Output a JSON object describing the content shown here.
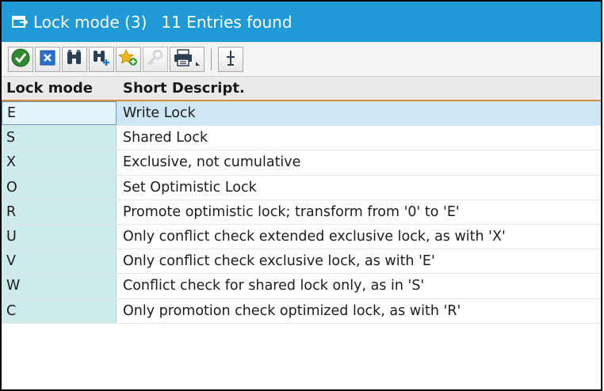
{
  "window": {
    "title_prefix": "Lock mode (3)",
    "title_suffix": "11 Entries found"
  },
  "toolbar": {
    "buttons": [
      {
        "icon": "check-icon"
      },
      {
        "icon": "cancel-x-icon"
      },
      {
        "icon": "binoculars-icon"
      },
      {
        "icon": "binoculars-plus-icon"
      },
      {
        "icon": "star-add-icon"
      },
      {
        "icon": "key-icon",
        "disabled": true
      },
      {
        "icon": "printer-icon"
      },
      {
        "icon": "column-marker-icon"
      }
    ]
  },
  "table": {
    "headers": [
      "Lock mode",
      "Short Descript."
    ],
    "rows": [
      {
        "mode": "E",
        "description": "Write Lock"
      },
      {
        "mode": "S",
        "description": "Shared Lock"
      },
      {
        "mode": "X",
        "description": "Exclusive, not cumulative"
      },
      {
        "mode": "O",
        "description": "Set Optimistic Lock"
      },
      {
        "mode": "R",
        "description": "Promote optimistic lock; transform from '0' to 'E'"
      },
      {
        "mode": "U",
        "description": "Only conflict check extended exclusive lock, as with 'X'"
      },
      {
        "mode": "V",
        "description": "Only conflict check exclusive lock, as with 'E'"
      },
      {
        "mode": "W",
        "description": "Conflict check for shared lock only, as in 'S'"
      },
      {
        "mode": "C",
        "description": "Only promotion check optimized lock, as with 'R'"
      }
    ]
  },
  "colors": {
    "titlebar": "#1f9ad7",
    "key_column": "#ccebea",
    "selected_row": "#cfe6f4",
    "header_underline": "#d88b3a"
  }
}
